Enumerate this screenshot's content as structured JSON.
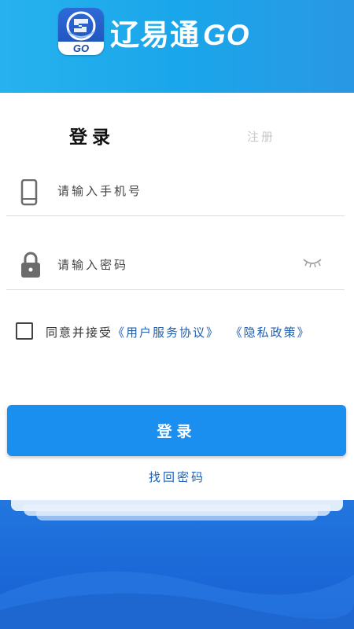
{
  "header": {
    "app_title": "辽易通",
    "app_title_suffix": "GO",
    "logo_badge": "GO",
    "colors": {
      "gradient_start": "#27b2ee",
      "gradient_end": "#2a97e4"
    }
  },
  "tabs": {
    "login": "登录",
    "register": "注册"
  },
  "phone": {
    "icon": "phone-icon",
    "placeholder": "请输入手机号"
  },
  "password": {
    "icon": "lock-icon",
    "placeholder": "请输入密码",
    "toggle_icon": "eye-closed-icon"
  },
  "agreement": {
    "checked": false,
    "text": "同意并接受",
    "user_agreement": "《用户服务协议》",
    "privacy_policy": "《隐私政策》"
  },
  "login_button": {
    "label": "登录",
    "color": "#1a8ff0"
  },
  "forgot_password": "找回密码",
  "footer": {
    "color": "#1b68d8"
  }
}
